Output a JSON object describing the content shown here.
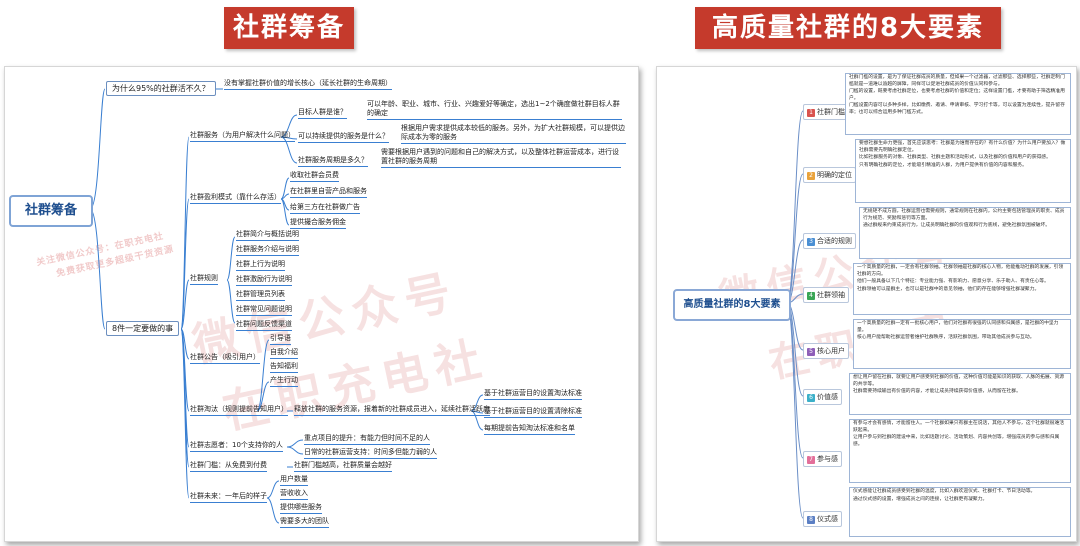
{
  "left": {
    "title": "社群筹备",
    "root": "社群筹备",
    "watermark_big_1": "微信公众号",
    "watermark_big_2": "在职充电社",
    "watermark_small_1": "关注微信公众号：在职充电社",
    "watermark_small_2": "免费获取更多超级干货资源",
    "branches": {
      "b1": "为什么95%的社群活不久？",
      "b1_child": "没有掌握社群价值的增长核心（延长社群的生命周期）",
      "b2": "8件一定要做的事",
      "g1": "社群服务（为用户解决什么问题）",
      "g1_items": [
        "目标人群是谁？",
        "可以持续提供的服务是什么？",
        "社群服务周期是多久？"
      ],
      "g1_desc": [
        "可以年龄、职业、城市、行业、兴趣爱好等确定，选出1~2个确度做社群目标人群的确定",
        "根据用户需求提供成本较低的服务。另外，为扩大社群规模，可以提供边际成本为零的服务",
        "需要根据用户遇到的问题和自己的解决方式，以及整体社群运营成本，进行设置社群的服务周期"
      ],
      "g2": "社群盈利模式（靠什么存活）",
      "g2_items": [
        "收取社群会员费",
        "在社群里自营产品和服务",
        "给第三方在社群做广告",
        "提供撮合服务佣金"
      ],
      "g3": "社群规则",
      "g3_items": [
        "社群简介与概括说明",
        "社群服务介绍与说明",
        "社群上行为说明",
        "社群激励行为说明",
        "社群管理员列表",
        "社群常见问题说明",
        "社群问题反馈渠道"
      ],
      "g4": "社群公告（吸引用户）",
      "g4_items": [
        "引导语",
        "自我介绍",
        "告知福利",
        "产生行动"
      ],
      "g5": "社群淘汰（规则提前告知用户）",
      "g5_desc": "释放社群的服务资源，报着新的社群成员进入，延续社群活跃度",
      "g5_items": [
        "基于社群运营目的设置淘汰标准",
        "基于社群运营目的设置清除标准",
        "每期提前告知淘汰标准和名单"
      ],
      "g6": "社群志愿者：10个支持你的人",
      "g6_items": [
        "重点项目的提升：有能力但时间不足的人",
        "日常的社群运营支持：时间多但能力弱的人"
      ],
      "g7": "社群门槛：从免费到付费",
      "g7_desc": "社群门槛越高，社群质量会越好",
      "g8": "社群未来：一年后的样子",
      "g8_items": [
        "用户数量",
        "营收收入",
        "提供哪些服务",
        "需要多大的团队"
      ]
    }
  },
  "right": {
    "title": "高质量社群的8大要素",
    "root": "高质量社群的8大要素",
    "watermark_big_1": "微信公众号",
    "watermark_big_2": "在职充电",
    "elements": [
      {
        "num": "1",
        "label": "社群门槛",
        "color": "#d9534f",
        "texts": [
          "社群门槛的设置，是为了保证社群成员的质量，但如果一个过滤器，过滤那些、选择那些，社群定制门槛就是一道难以逾越的屏障，同样可以促进社群成员的价值认同和参与。",
          "门槛的设置，既要考虑社群定位，也要考虑社群的价值和定位；这样设置门槛，才要有助于筛选精准用户。",
          "门槛设置内容可以多种多样，比如缴费、邀请、申请审核、学习打卡等，可以设置为连续性，提升留存率；也可以综合运用多种门槛方式。"
        ]
      },
      {
        "num": "2",
        "label": "明确的定位",
        "color": "#e9a23b",
        "texts": [
          "要想社群生命力更强，首先应该思考：社群是为谁而存在的？有什么价值？为什么用户要加入？做社群需要先明确社群定位。",
          "比如社群服务的对象、社群类型、社群主题和活动形式，以及社群的价值和用户的获得感。",
          "只有明确社群的定位，才能吸引精准的人群，为用户提供有价值的内容和服务。"
        ]
      },
      {
        "num": "3",
        "label": "合适的规则",
        "color": "#4a8fd4",
        "texts": [
          "无规矩不成方圆，社群运营也需要规则，通常规则在社群内，公约主要包括管理员的职责、成员行为规范、奖励和惩罚等方面。",
          "通过群规来约束成员行为，让成员明确社群的价值观和行为底线，避免社群氛围被破坏。"
        ]
      },
      {
        "num": "4",
        "label": "社群领袖",
        "color": "#3aa655",
        "texts": [
          "一个高质量的社群，一定会有社群领袖。社群领袖是社群的核心人物，他能推动社群的发展，引领社群的方向。",
          "他们一般具备以下几个特征：专业能力强、有影响力、愿意分享、乐于助人、有责任心等。",
          "社群领袖可以是群主，也可以是社群中的意见领袖，他们的存在能够增强社群凝聚力。"
        ]
      },
      {
        "num": "5",
        "label": "核心用户",
        "color": "#8e5fb8",
        "texts": [
          "一个高质量的社群一定有一批核心用户，他们对社群有很强的认同感和归属感，是社群的中坚力量。",
          "核心用户能帮助社群运营者维护社群秩序，活跃社群氛围，带动其他成员参与互动。"
        ]
      },
      {
        "num": "6",
        "label": "价值感",
        "color": "#3bb0c9",
        "texts": [
          "想让用户留在社群，就要让用户感受到社群的价值，这种价值可能是知识的获取、人脉的拓展、资源的共享等。",
          "社群需要持续输出有价值的内容，才能让成员持续获得价值感，从而留在社群。"
        ]
      },
      {
        "num": "7",
        "label": "参与感",
        "color": "#e36f9a",
        "texts": [
          "有参与才会有感情，才能留住人。一个社群如果只有群主在说话，其他人不参与，这个社群就很难活跃起来。",
          "让用户参与到社群的建设中来，比如话题讨论、活动策划、内容共创等，增强成员的参与感和归属感。"
        ]
      },
      {
        "num": "8",
        "label": "仪式感",
        "color": "#5b7fc4",
        "texts": [
          "仪式感能让社群成员感受到社群的温度，比如入群欢迎仪式、社群打卡、节日活动等。",
          "通过仪式感的设置，增强成员之间的连接，让社群更有凝聚力。"
        ]
      }
    ]
  }
}
